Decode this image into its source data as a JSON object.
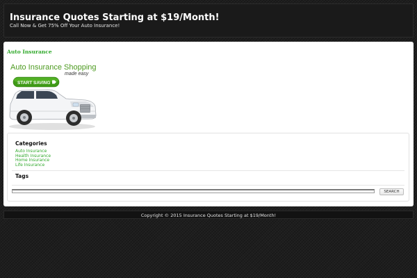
{
  "header": {
    "site_title": "Insurance Quotes Starting at $19/Month!",
    "tagline": "Call Now & Get 75% Off Your Auto Insurance!"
  },
  "post": {
    "title": "Auto Insurance",
    "ad": {
      "headline": "Auto Insurance Shopping",
      "subheadline": "made easy",
      "button_label": "START SAVING"
    }
  },
  "sidebar": {
    "categories_title": "Categories",
    "categories": [
      "Auto Insurance",
      "Health Insurance",
      "Home Insurance",
      "Life Insurance"
    ],
    "tags_title": "Tags",
    "search": {
      "value": "",
      "button_label": "SEARCH"
    }
  },
  "footer": {
    "copyright": "Copyright © 2015 Insurance Quotes Starting at $19/Month!"
  },
  "colors": {
    "accent_green": "#2fa82a",
    "background": "#1e1e1e",
    "panel": "#ffffff"
  }
}
